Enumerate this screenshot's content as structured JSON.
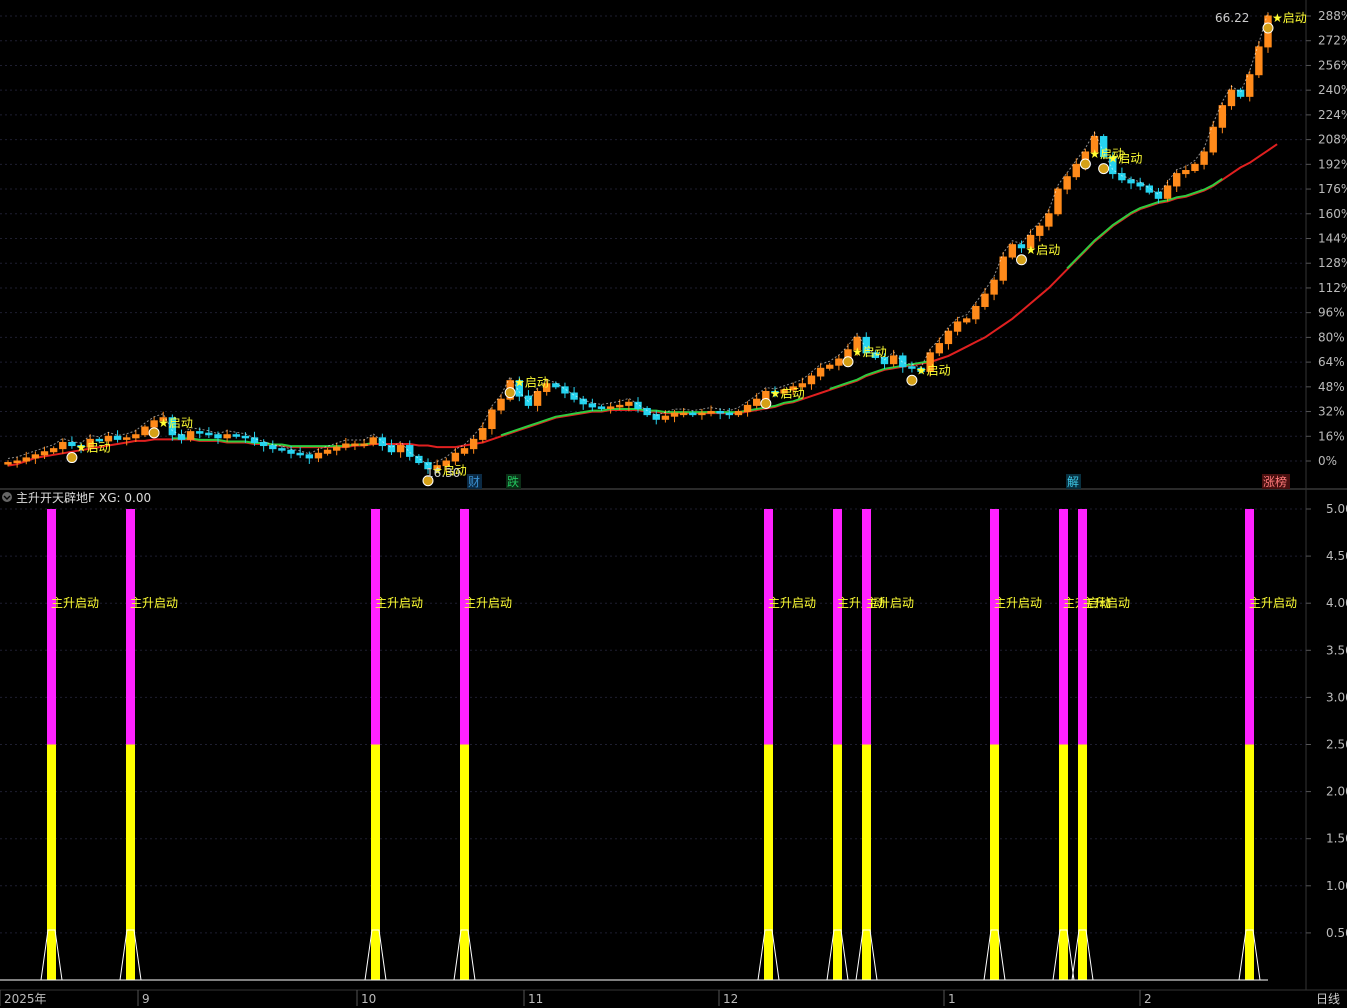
{
  "upper_panel": {
    "y_axis_ticks": [
      "288%",
      "272%",
      "256%",
      "240%",
      "224%",
      "208%",
      "192%",
      "176%",
      "160%",
      "144%",
      "128%",
      "112%",
      "96%",
      "80%",
      "64%",
      "48%",
      "32%",
      "16%",
      "0%"
    ],
    "high_label": "66.22",
    "low_label": "16.30",
    "signal_text": "★启动",
    "event_badges": [
      {
        "text": "财",
        "color": "#3a8fd0",
        "bg": "#0b2a44"
      },
      {
        "text": "跌",
        "color": "#22c55e",
        "bg": "#0b2e16"
      },
      {
        "text": "解",
        "color": "#3ec7e6",
        "bg": "#083040"
      },
      {
        "text": "涨榜",
        "color": "#ff7a7a",
        "bg": "#4a1010"
      }
    ]
  },
  "lower_panel": {
    "title": "主升开天辟地F",
    "xg_label": "XG: 0.00",
    "signal_label": "主升启动",
    "y_axis_ticks": [
      "5.00",
      "4.50",
      "4.00",
      "3.50",
      "3.00",
      "2.50",
      "2.00",
      "1.50",
      "1.00",
      "0.50"
    ]
  },
  "x_axis_labels": [
    "2025年",
    "9",
    "10",
    "11",
    "12",
    "1",
    "2"
  ],
  "period_label": "日线",
  "colors": {
    "up_candle": "#ff8a1a",
    "down_candle": "#26d4f0",
    "ma_red": "#e02020",
    "ma_green": "#2ecc40",
    "bar_magenta": "#ff22ff",
    "bar_yellow": "#ffff00"
  },
  "chart_data": [
    {
      "type": "candlestick",
      "ylabel": "",
      "ylim": [
        -10,
        295
      ],
      "price_pct_series": [
        -1,
        0,
        2,
        4,
        6,
        8,
        12,
        10,
        9,
        14,
        13,
        16,
        14,
        15,
        17,
        22,
        26,
        28,
        17,
        14,
        19,
        18,
        17,
        15,
        17,
        16,
        15,
        12,
        10,
        8,
        7,
        5,
        4,
        2,
        5,
        7,
        9,
        11,
        11,
        11,
        15,
        10,
        6,
        10,
        3,
        -1,
        -5,
        -3,
        0,
        5,
        8,
        14,
        21,
        33,
        40,
        52,
        42,
        36,
        45,
        50,
        48,
        44,
        40,
        37,
        35,
        34,
        35,
        36,
        38,
        34,
        30,
        27,
        29,
        31,
        31,
        30,
        31,
        32,
        31,
        30,
        32,
        36,
        40,
        45,
        44,
        46,
        48,
        50,
        55,
        60,
        62,
        66,
        72,
        80,
        70,
        67,
        63,
        68,
        61,
        60,
        58,
        70,
        76,
        84,
        90,
        92,
        100,
        108,
        117,
        132,
        140,
        138,
        146,
        152,
        160,
        176,
        184,
        192,
        200,
        210,
        197,
        186,
        182,
        180,
        178,
        174,
        170,
        178,
        186,
        188,
        192,
        200,
        216,
        230,
        240,
        236,
        250,
        268,
        288
      ],
      "ma_red_pct": [
        -3,
        -2,
        0,
        2,
        3,
        4,
        5,
        6,
        7,
        8,
        9,
        10,
        11,
        12,
        13,
        13,
        14,
        14,
        14,
        14,
        14,
        13,
        13,
        13,
        12,
        12,
        12,
        11,
        11,
        10,
        10,
        9,
        9,
        9,
        9,
        9,
        9,
        9,
        10,
        10,
        11,
        11,
        11,
        11,
        11,
        10,
        10,
        9,
        9,
        9,
        10,
        11,
        12,
        14,
        16,
        18,
        20,
        22,
        24,
        26,
        28,
        29,
        30,
        31,
        32,
        32,
        33,
        33,
        33,
        33,
        32,
        32,
        31,
        31,
        31,
        31,
        31,
        31,
        31,
        31,
        31,
        32,
        33,
        34,
        35,
        37,
        38,
        40,
        42,
        44,
        46,
        48,
        50,
        52,
        55,
        57,
        59,
        60,
        61,
        62,
        63,
        64,
        66,
        68,
        71,
        74,
        77,
        80,
        84,
        88,
        92,
        97,
        102,
        107,
        112,
        118,
        124,
        130,
        136,
        142,
        147,
        152,
        156,
        160,
        163,
        165,
        167,
        168,
        170,
        171,
        173,
        175,
        178,
        182,
        186,
        190,
        193,
        197,
        201,
        205
      ],
      "ma_green_segments": [
        [
          18,
          40
        ],
        [
          54,
          87
        ],
        [
          90,
          101
        ],
        [
          116,
          133
        ]
      ]
    },
    {
      "type": "bar",
      "series_name": "主升启动",
      "signal_bar_indices": [
        11,
        28,
        80,
        99,
        169,
        184,
        190,
        217,
        231,
        235,
        268
      ],
      "bar_value": 5.0,
      "yellow_part": 2.5,
      "ylim": [
        0,
        5.2
      ]
    }
  ]
}
